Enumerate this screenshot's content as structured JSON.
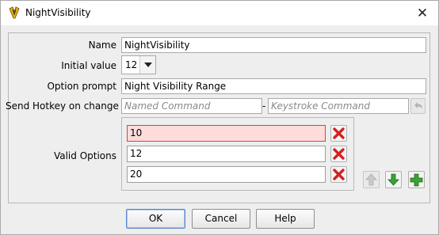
{
  "window": {
    "title": "NightVisibility",
    "close_glyph": "✕",
    "icon": "vassal-app-icon"
  },
  "form": {
    "name_label": "Name",
    "name_value": "NightVisibility",
    "initial_label": "Initial value",
    "initial_value": "12",
    "prompt_label": "Option prompt",
    "prompt_value": "Night Visibility Range",
    "hotkey_label": "Send Hotkey on change",
    "named_command_placeholder": "Named Command",
    "separator": "-",
    "keystroke_placeholder": "Keystroke Command",
    "valid_options_label": "Valid Options",
    "options": [
      {
        "value": "10",
        "invalid": true
      },
      {
        "value": "12",
        "invalid": false
      },
      {
        "value": "20",
        "invalid": false
      }
    ]
  },
  "buttons": {
    "ok": "OK",
    "cancel": "Cancel",
    "help": "Help"
  },
  "colors": {
    "invalid_bg": "#ffdcdc",
    "delete_red": "#d42020",
    "add_green": "#3aa335",
    "default_border": "#5b86c6"
  }
}
